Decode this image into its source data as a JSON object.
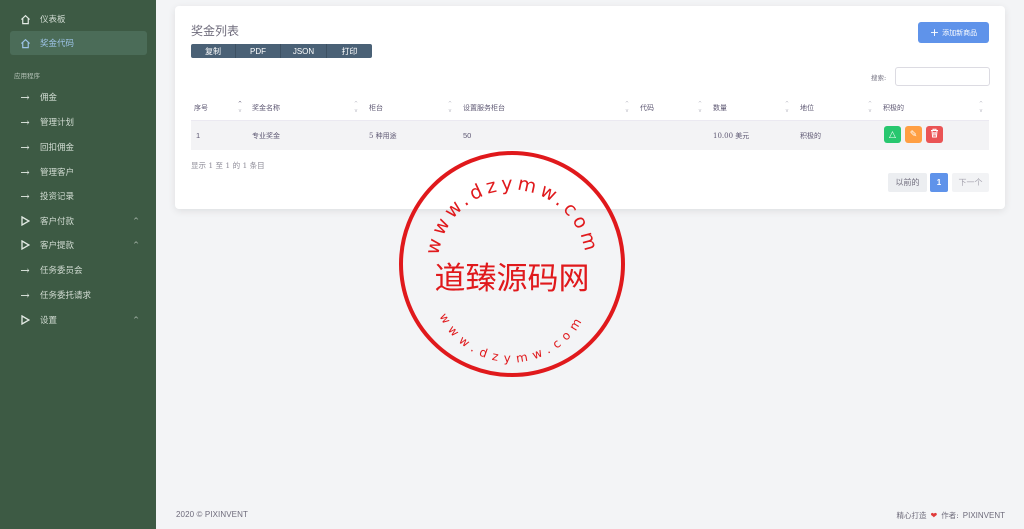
{
  "sidebar": {
    "section_label": "应用程序",
    "items": [
      {
        "label": "仪表板",
        "icon": "home-icon",
        "caret": ""
      },
      {
        "label": "奖金代码",
        "icon": "home-icon",
        "caret": "",
        "active": true
      },
      {
        "label": "佣金",
        "icon": "arrow-right-icon",
        "caret": ""
      },
      {
        "label": "管理计划",
        "icon": "arrow-right-icon",
        "caret": ""
      },
      {
        "label": "回扣佣金",
        "icon": "arrow-right-icon",
        "caret": ""
      },
      {
        "label": "管理客户",
        "icon": "arrow-right-icon",
        "caret": ""
      },
      {
        "label": "投资记录",
        "icon": "arrow-right-icon",
        "caret": ""
      },
      {
        "label": "客户付款",
        "icon": "play-icon",
        "caret": "^"
      },
      {
        "label": "客户提款",
        "icon": "play-icon",
        "caret": "^"
      },
      {
        "label": "任务委员会",
        "icon": "arrow-right-icon",
        "caret": ""
      },
      {
        "label": "任务委托请求",
        "icon": "arrow-right-icon",
        "caret": ""
      },
      {
        "label": "设置",
        "icon": "play-icon",
        "caret": "^"
      }
    ]
  },
  "card": {
    "title": "奖金列表",
    "add_button": {
      "icon": "+",
      "label": "添加新商品"
    },
    "export_buttons": [
      "复制",
      "PDF",
      "JSON",
      "打印"
    ],
    "search_label": "搜索:",
    "search_value": "",
    "columns": [
      "序号",
      "奖金名称",
      "柜台",
      "设置服务柜台",
      "代码",
      "数量",
      "地位",
      "积极的"
    ],
    "rows": [
      {
        "index": "1",
        "name": "专业奖金",
        "counter": "5 种用途",
        "service_counter": "50",
        "code": "",
        "amount": "10.00 美元",
        "status": "积极的"
      }
    ],
    "actions": [
      {
        "name": "status-action-button",
        "icon": "△",
        "color": "#28c76f"
      },
      {
        "name": "edit-action-button",
        "icon": "✎",
        "color": "#ff9f43"
      },
      {
        "name": "delete-action-button",
        "icon": "🗑",
        "color": "#ea5455"
      }
    ],
    "info": "显示 1 至 1 的 1 条目",
    "pagination": {
      "prev": "以前的",
      "current": "1",
      "next": "下一个"
    }
  },
  "watermark": {
    "center": "道臻源码网",
    "ring_text": "www.dzymw.com",
    "color": "#e0191c"
  },
  "footer": {
    "copyright": "2020 © PIXINVENT",
    "made_with": "精心打造",
    "heart": "❤",
    "author_label": "作者:",
    "author": "PIXINVENT"
  }
}
